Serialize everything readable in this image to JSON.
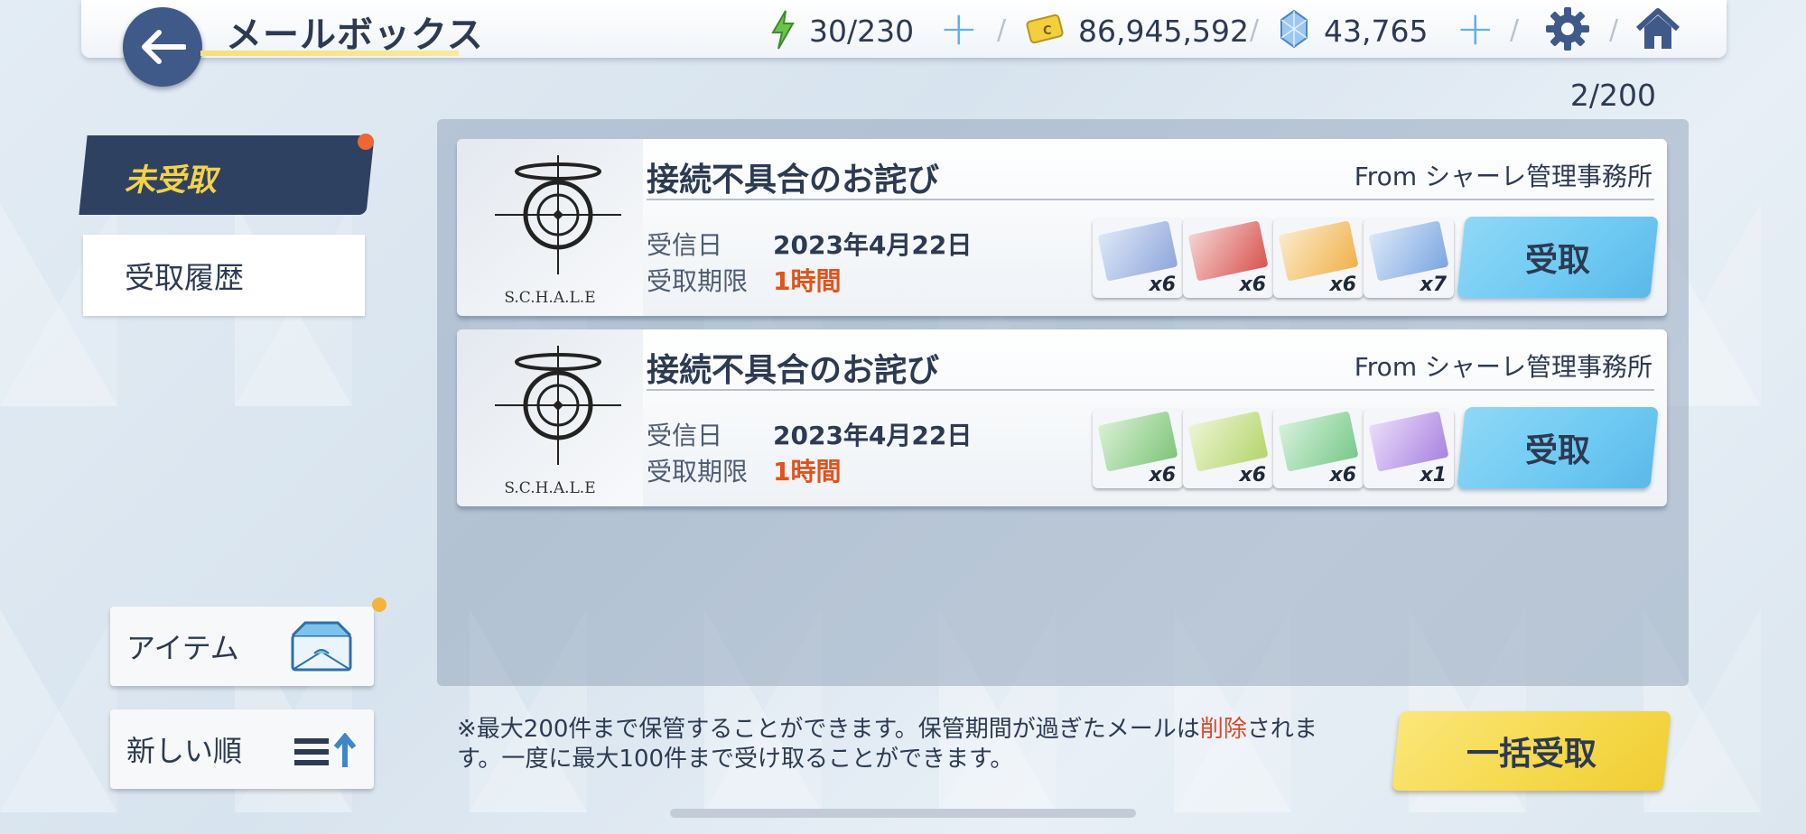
{
  "header": {
    "title": "メールボックス",
    "ap": "30/230",
    "credits": "86,945,592",
    "pyroxene": "43,765"
  },
  "mail_count": "2/200",
  "tabs": {
    "unreceived": "未受取",
    "history": "受取履歴"
  },
  "side": {
    "item_label": "アイテム",
    "sort_label": "新しい順"
  },
  "mails": [
    {
      "title": "接続不具合のお詫び",
      "from": "From シャーレ管理事務所",
      "logo_text": "S.C.H.A.L.E",
      "received_label": "受信日",
      "received_date": "2023年4月22日",
      "deadline_label": "受取期限",
      "deadline": "1時間",
      "items": [
        {
          "qty": "x6",
          "color": "#8fa7dc"
        },
        {
          "qty": "x6",
          "color": "#d9534f"
        },
        {
          "qty": "x6",
          "color": "#f0b24a"
        },
        {
          "qty": "x7",
          "color": "#7ba6e2"
        }
      ],
      "button": "受取"
    },
    {
      "title": "接続不具合のお詫び",
      "from": "From シャーレ管理事務所",
      "logo_text": "S.C.H.A.L.E",
      "received_label": "受信日",
      "received_date": "2023年4月22日",
      "deadline_label": "受取期限",
      "deadline": "1時間",
      "items": [
        {
          "qty": "x6",
          "color": "#7fc57a"
        },
        {
          "qty": "x6",
          "color": "#b4d56b"
        },
        {
          "qty": "x6",
          "color": "#79c98a"
        },
        {
          "qty": "x1",
          "color": "#a883e0"
        }
      ],
      "button": "受取"
    }
  ],
  "notice": {
    "part1": "※最大200件まで保管することができます。保管期間が過ぎたメールは",
    "highlight": "削除",
    "part2": "されます。一度に最大100件まで受け取ることができます。"
  },
  "bulk_button": "一括受取",
  "colors": {
    "active_tab": "#2f4161",
    "active_tab_text": "#f3d24a",
    "receive_button": "#6ec9f2",
    "bulk_button": "#f5d84a",
    "deadline": "#e0531c",
    "notification_dot": "#ee6633"
  }
}
